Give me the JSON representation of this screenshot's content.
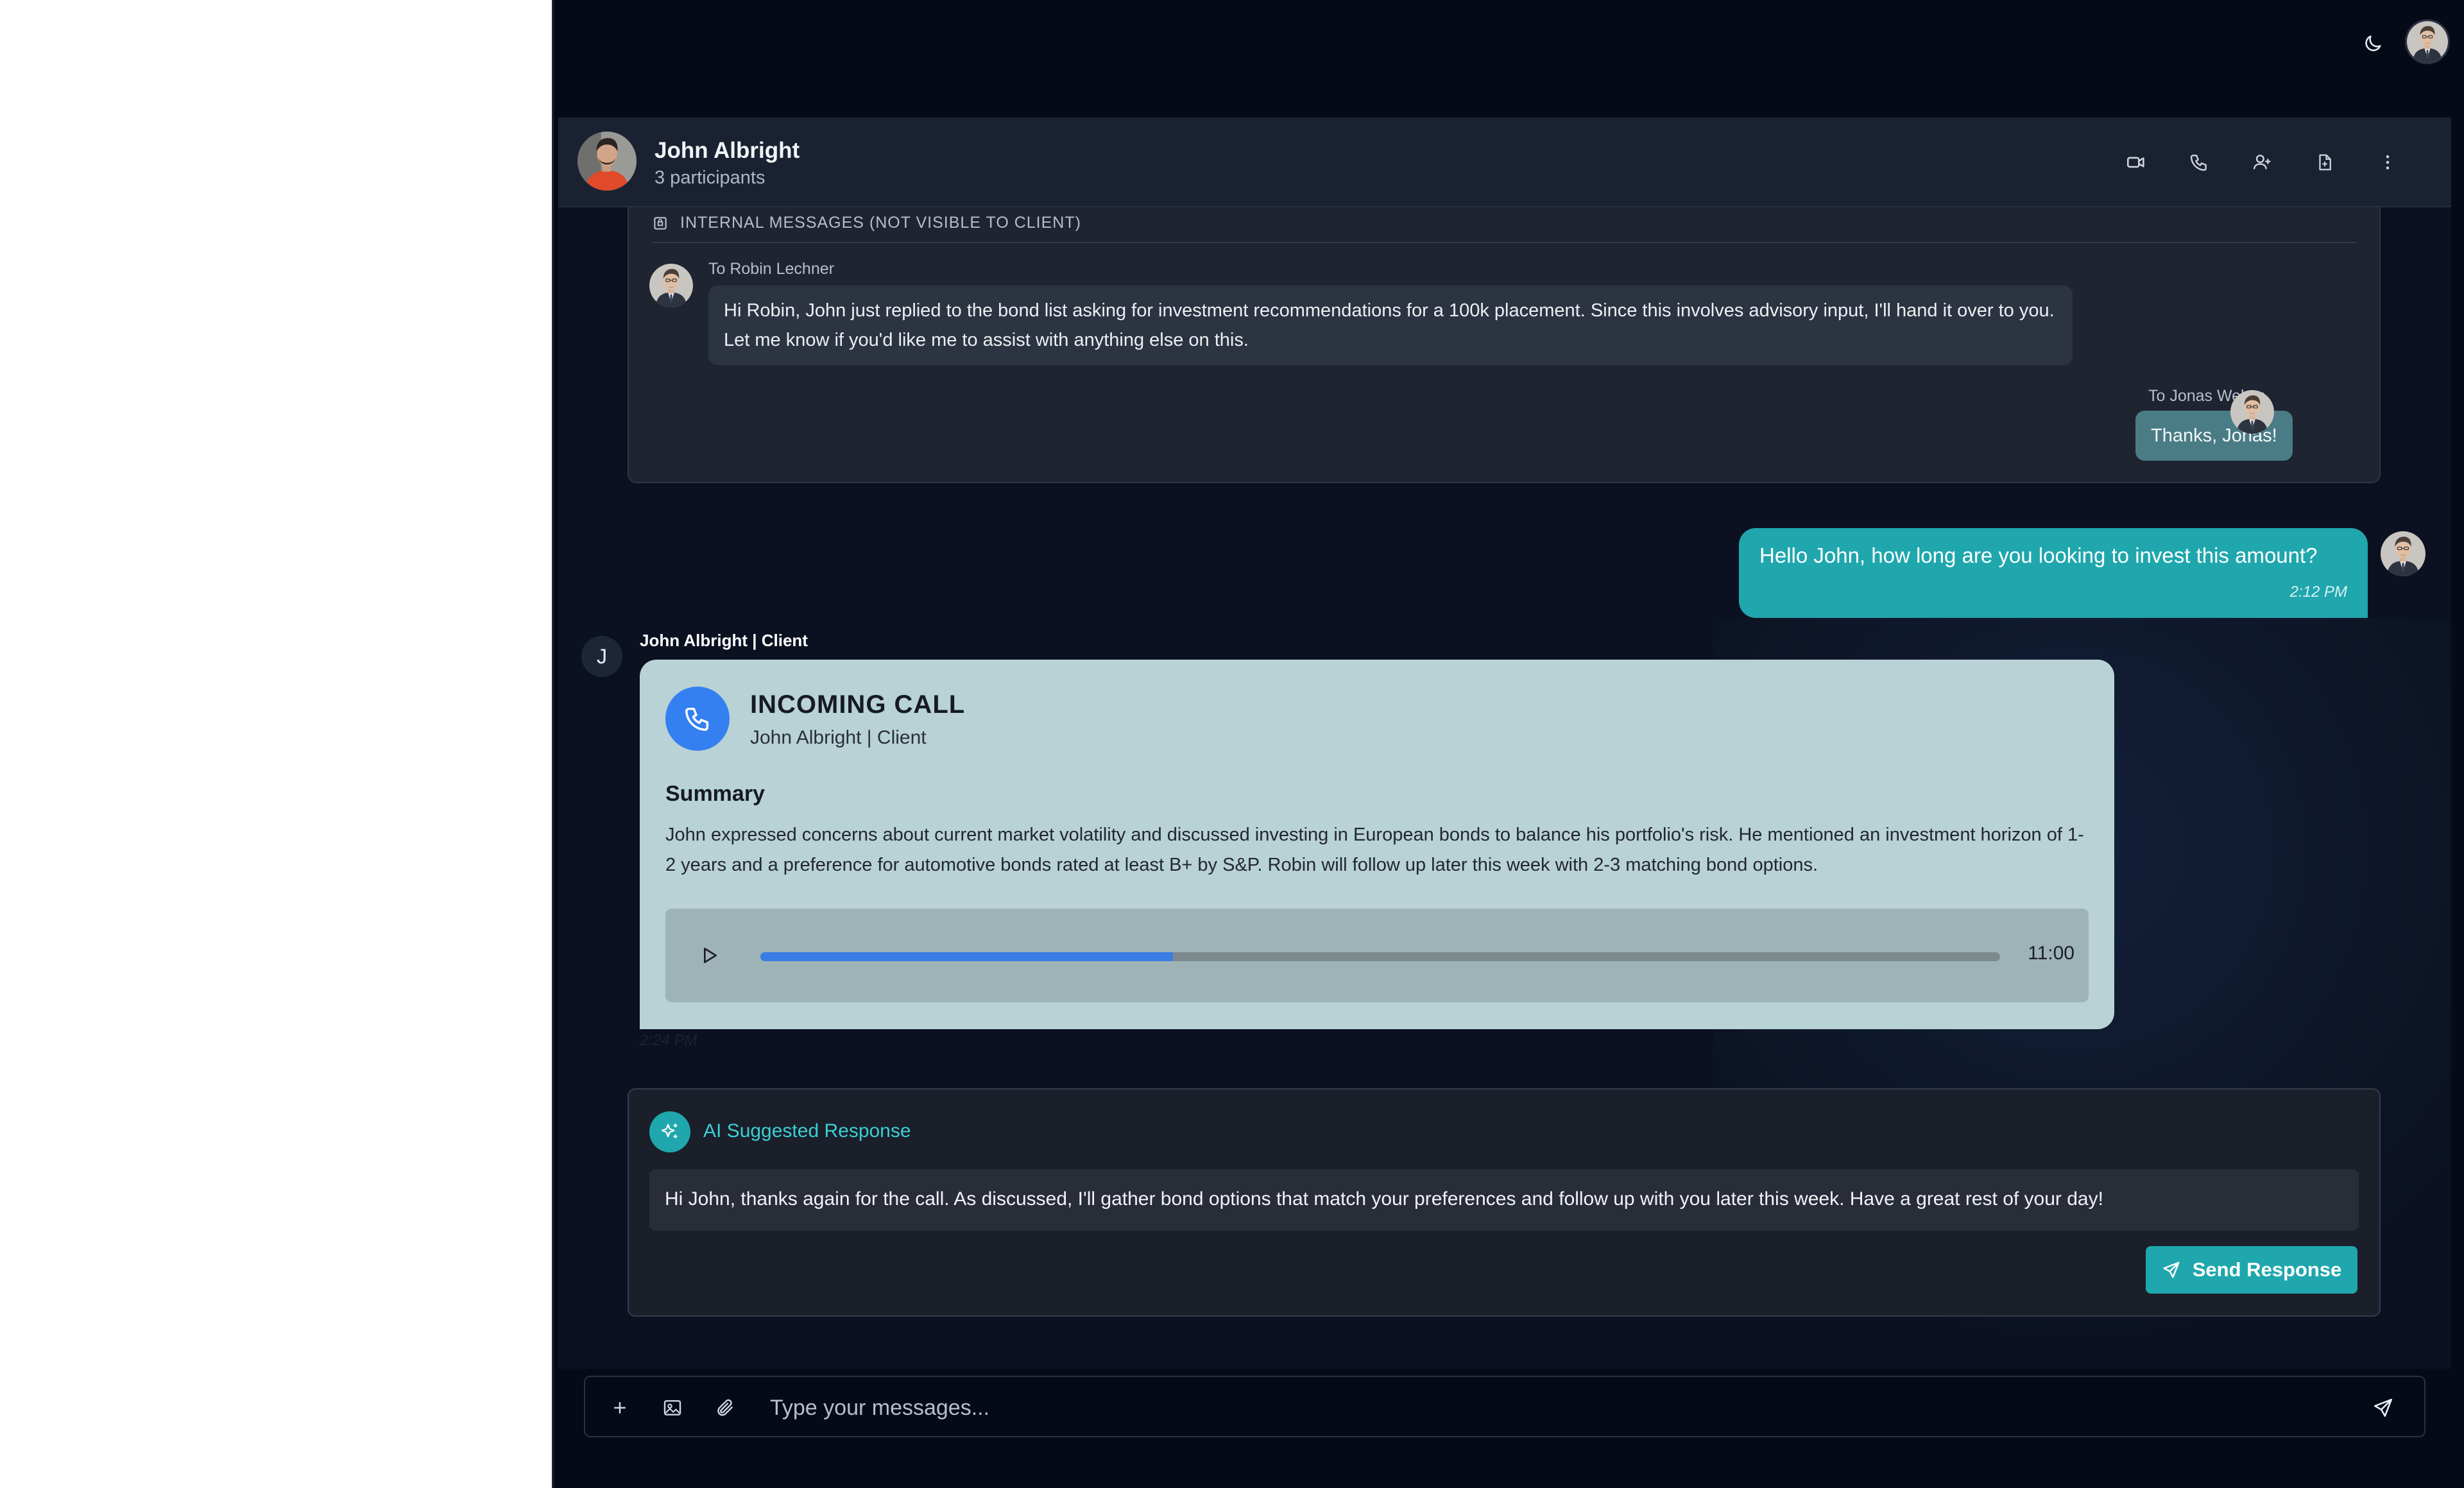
{
  "header": {
    "contact_name": "John Albright",
    "participants": "3 participants",
    "actions": [
      "video-call",
      "voice-call",
      "add-participant",
      "document",
      "more-options"
    ]
  },
  "internal": {
    "label": "INTERNAL MESSAGES (NOT VISIBLE TO CLIENT)",
    "messages": [
      {
        "to": "To Robin Lechner",
        "text": "Hi Robin, John just replied to the bond list asking for investment recommendations for a 100k placement. Since this involves advisory input, I'll hand it over to you. Let me know if you'd like me to assist with anything else on this."
      },
      {
        "to": "To Jonas Weber",
        "text": "Thanks, Jonas!"
      }
    ]
  },
  "outgoing": {
    "text": "Hello John, how long are you looking to invest this amount?",
    "time": "2:12 PM"
  },
  "call": {
    "avatar_initial": "J",
    "sender": "John Albright | Client",
    "title": "INCOMING CALL",
    "caller": "John Albright | Client",
    "summary_title": "Summary",
    "summary": "John expressed concerns about current market volatility and discussed investing in European bonds to balance his portfolio's risk. He mentioned an investment horizon of 1-2 years and a preference for automotive bonds rated at least B+ by S&P. Robin will follow up later this week with 2-3 matching bond options.",
    "duration": "11:00",
    "progress_fraction": 0.333,
    "time": "2:24 PM"
  },
  "ai": {
    "label": "AI Suggested Response",
    "text": "Hi John, thanks again for the call. As discussed, I'll gather bond options that match your preferences and follow up with you later this week. Have a great rest of your day!",
    "send_label": "Send Response"
  },
  "composer": {
    "placeholder": "Type your messages..."
  },
  "colors": {
    "accent": "#1fa7ad",
    "call_blue": "#3480f0",
    "card": "#b8d2d5"
  }
}
